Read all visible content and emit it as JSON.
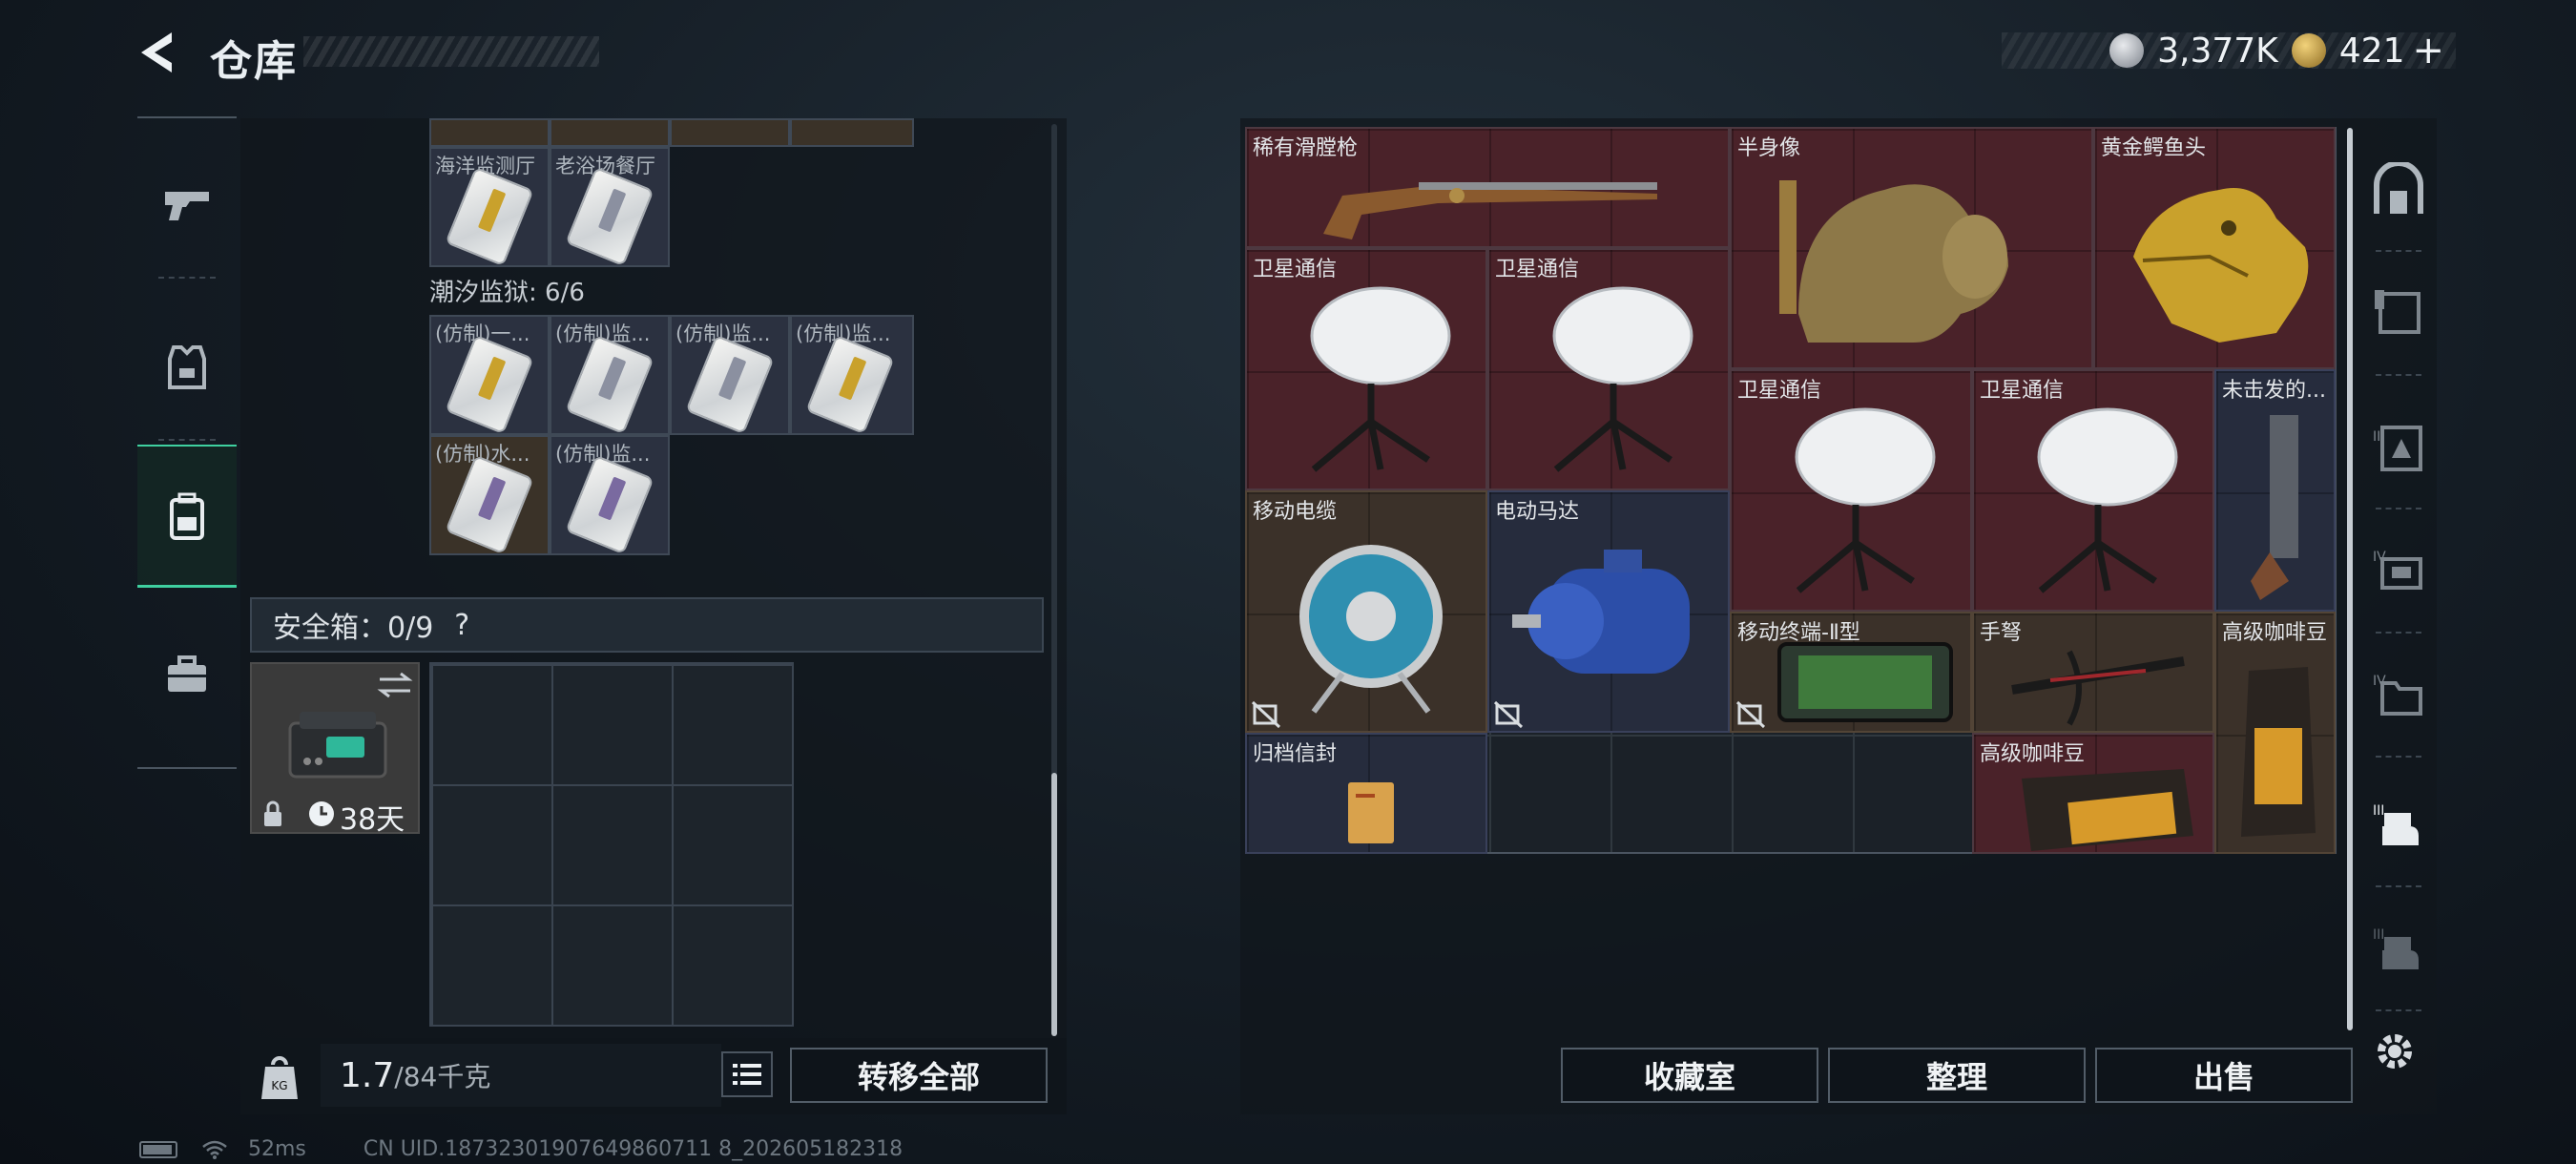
{
  "header": {
    "title": "仓库",
    "currency_silver": "3,377K",
    "currency_gold": "421",
    "currency_plus": "+"
  },
  "left_panel": {
    "top_row_labels": [
      "海洋监测厅",
      "老浴场餐厅"
    ],
    "section_label": "潮汐监狱: 6/6",
    "prison_items": [
      "(仿制)一...",
      "(仿制)监...",
      "(仿制)监...",
      "(仿制)监...",
      "(仿制)水...",
      "(仿制)监..."
    ],
    "safebox_label": "安全箱：0/9",
    "safebox_help": "?",
    "safebox_timer": "38天",
    "weight_value": "1.7",
    "weight_max": "/84千克",
    "transfer_all_label": "转移全部"
  },
  "right_panel": {
    "items": [
      {
        "name": "稀有滑膛枪"
      },
      {
        "name": "半身像"
      },
      {
        "name": "黄金鳄鱼头"
      },
      {
        "name": "卫星通信"
      },
      {
        "name": "卫星通信"
      },
      {
        "name": "卫星通信"
      },
      {
        "name": "卫星通信"
      },
      {
        "name": "未击发的..."
      },
      {
        "name": "移动电缆"
      },
      {
        "name": "电动马达"
      },
      {
        "name": "移动终端-Ⅱ型"
      },
      {
        "name": "手弩"
      },
      {
        "name": "高级咖啡豆"
      },
      {
        "name": "归档信封"
      },
      {
        "name": "高级咖啡豆"
      }
    ],
    "collection_label": "收藏室",
    "sort_label": "整理",
    "sell_label": "出售"
  },
  "status": {
    "ping": "52ms",
    "uid": "CN UID.18732301907649860711 8_202605182318"
  },
  "colors": {
    "accent_green": "#3fd0a0",
    "item_red": "#4a2229",
    "item_brown": "#3b3129",
    "item_navy": "#262c3d"
  }
}
